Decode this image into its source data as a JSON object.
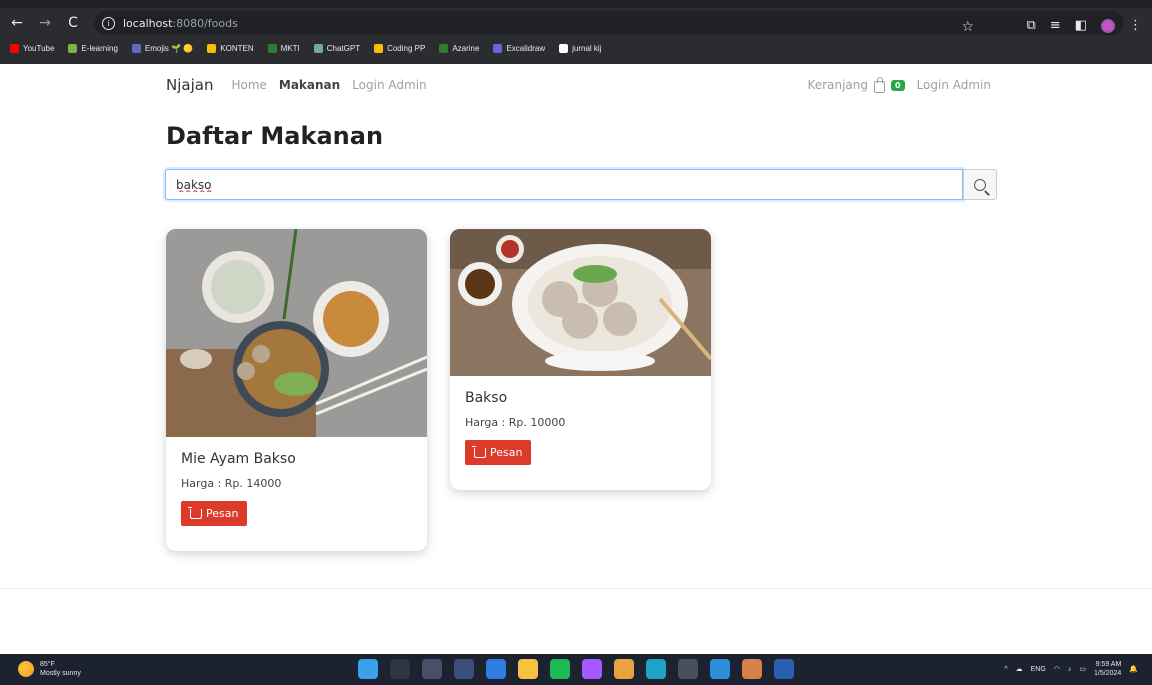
{
  "browser": {
    "url_host": "localhost",
    "url_rest": ":8080/foods",
    "bookmarks": [
      {
        "label": "YouTube",
        "color": "#ff0000"
      },
      {
        "label": "E-learning",
        "color": "#7cb342"
      },
      {
        "label": "Emojis 🌱 🟡",
        "color": "#5c6bc0"
      },
      {
        "label": "KONTEN",
        "color": "#fbbc04"
      },
      {
        "label": "MKTI",
        "color": "#2e7d32"
      },
      {
        "label": "ChatGPT",
        "color": "#74aa9c"
      },
      {
        "label": "Coding PP",
        "color": "#fbbc04"
      },
      {
        "label": "Azarine",
        "color": "#2e7d32"
      },
      {
        "label": "Excalidraw",
        "color": "#6965db"
      },
      {
        "label": "jurnal kij",
        "color": "#ffffff"
      }
    ]
  },
  "site": {
    "brand": "Njajan",
    "nav": {
      "home": "Home",
      "makanan": "Makanan",
      "login_admin": "Login Admin"
    },
    "cart": {
      "label": "Keranjang",
      "count": "0"
    },
    "login_right": "Login Admin"
  },
  "heading": {
    "prefix": "Daftar",
    "bold": "Makanan"
  },
  "search": {
    "value": "bakso"
  },
  "foods": [
    {
      "name": "Mie Ayam Bakso",
      "price": "Harga : Rp. 14000",
      "button": "Pesan"
    },
    {
      "name": "Bakso",
      "price": "Harga : Rp. 10000",
      "button": "Pesan"
    }
  ],
  "taskbar": {
    "temp": "85°F",
    "weather": "Mostly sunny",
    "lang": "ENG",
    "time": "9:59 AM",
    "date": "1/5/2024"
  }
}
